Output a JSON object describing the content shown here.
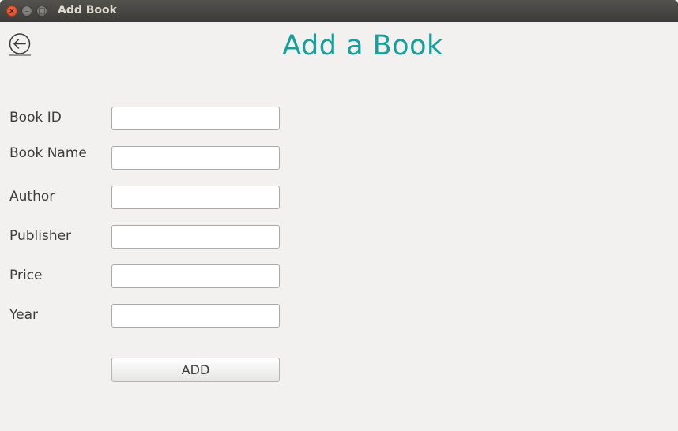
{
  "window": {
    "title": "Add Book",
    "close_glyph": "×",
    "minimize_glyph": "–",
    "maximize_glyph": "□"
  },
  "header": {
    "title": "Add a Book",
    "back_icon": "arrow-left-circle-icon"
  },
  "form": {
    "fields": [
      {
        "label": "Book ID",
        "value": "",
        "placeholder": ""
      },
      {
        "label": "Book Name",
        "value": "",
        "placeholder": ""
      },
      {
        "label": "Author",
        "value": "",
        "placeholder": ""
      },
      {
        "label": "Publisher",
        "value": "",
        "placeholder": ""
      },
      {
        "label": "Price",
        "value": "",
        "placeholder": ""
      },
      {
        "label": "Year",
        "value": "",
        "placeholder": ""
      }
    ],
    "submit_label": "ADD"
  },
  "colors": {
    "title_accent": "#14a19b",
    "titlebar": "#3c3b37",
    "background": "#f2f1f0"
  }
}
